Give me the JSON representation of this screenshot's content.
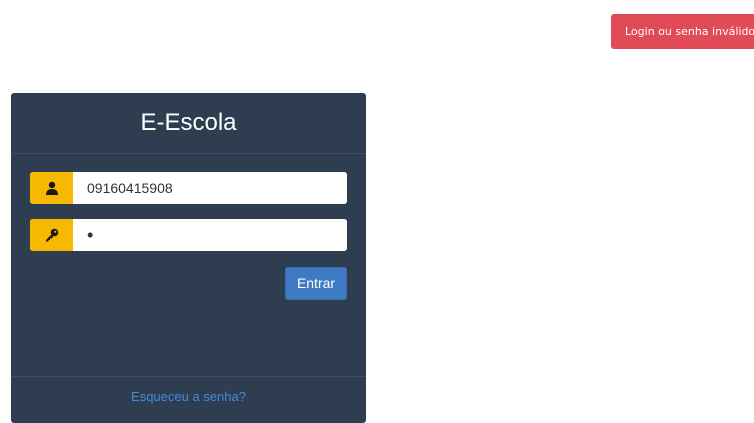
{
  "toast": {
    "message": "Login ou senha inválido",
    "color": "#e04b55"
  },
  "login": {
    "title": "E-Escola",
    "username_value": "09160415908",
    "password_masked": "•",
    "submit_label": "Entrar",
    "forgot_link": "Esqueceu a senha?",
    "icons": {
      "user": "user-icon",
      "key": "key-icon"
    },
    "colors": {
      "panel": "#2e3e50",
      "addon": "#f6b800",
      "button": "#3e7bc4",
      "link": "#3f8ce0"
    }
  }
}
